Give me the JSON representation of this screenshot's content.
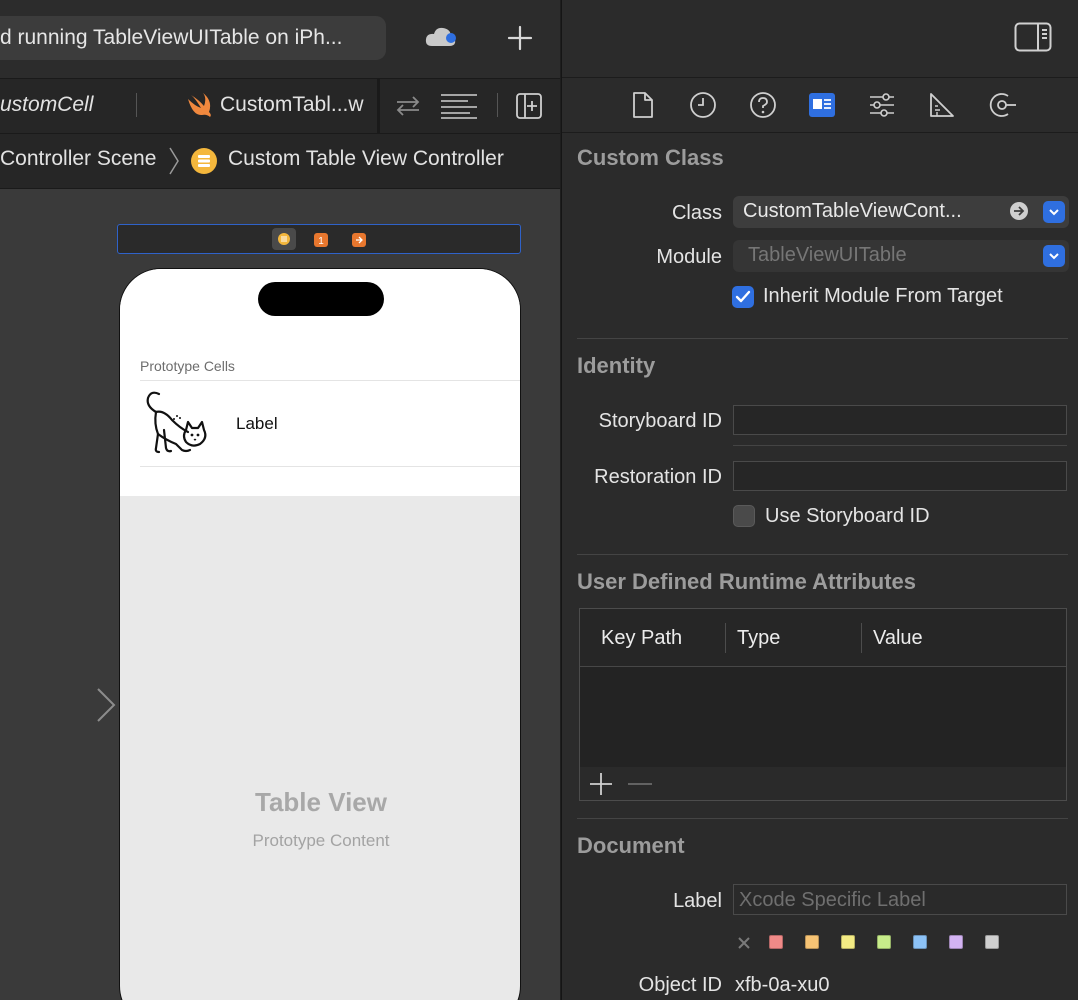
{
  "toolbar": {
    "activity_text": "d running TableViewUITable on iPh...",
    "add_label": "+"
  },
  "tabs": [
    {
      "label": "ustomCell"
    },
    {
      "label": "CustomTabl...w"
    }
  ],
  "jumpbar": {
    "scene": "Controller Scene",
    "controller": "Custom Table View Controller"
  },
  "phone": {
    "section_header": "Prototype Cells",
    "cell_label": "Label",
    "table_title": "Table View",
    "table_subtitle": "Prototype Content"
  },
  "inspector": {
    "custom_class": {
      "title": "Custom Class",
      "class_label": "Class",
      "class_value": "CustomTableViewCont...",
      "module_label": "Module",
      "module_placeholder": "TableViewUITable",
      "inherit_label": "Inherit Module From Target",
      "inherit_checked": true
    },
    "identity": {
      "title": "Identity",
      "storyboard_id_label": "Storyboard ID",
      "storyboard_id_value": "",
      "restoration_id_label": "Restoration ID",
      "restoration_id_value": "",
      "use_storyboard_label": "Use Storyboard ID",
      "use_storyboard_checked": false
    },
    "runtime_attributes": {
      "title": "User Defined Runtime Attributes",
      "columns": [
        "Key Path",
        "Type",
        "Value"
      ],
      "add_label": "+",
      "remove_label": "—"
    },
    "document": {
      "title": "Document",
      "label_label": "Label",
      "label_placeholder": "Xcode Specific Label",
      "swatches": [
        "#f08a88",
        "#f6c374",
        "#f3eb84",
        "#c7ec8a",
        "#8cc2f6",
        "#d3b3f2",
        "#cfcfcf"
      ],
      "object_id_label": "Object ID",
      "object_id_value": "xfb-0a-xu0"
    }
  },
  "colors": {
    "accent": "#2f6fe0",
    "panel": "#2b2b2b",
    "canvas": "#3a3a3a"
  }
}
